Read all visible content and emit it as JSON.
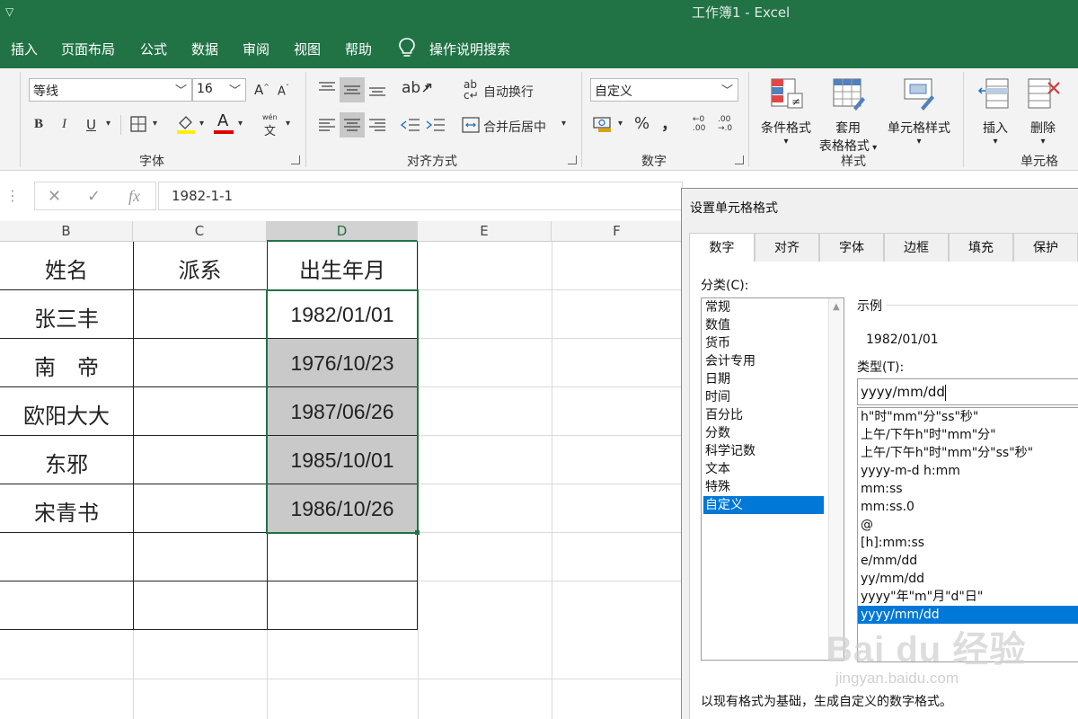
{
  "titlebar": {
    "qat_arrow": "▽",
    "title": "工作簿1 - Excel"
  },
  "menu": {
    "tabs": [
      "插入",
      "页面布局",
      "公式",
      "数据",
      "审阅",
      "视图",
      "帮助"
    ],
    "tellme": "操作说明搜索"
  },
  "ribbon": {
    "font": {
      "name": "等线",
      "size": "16",
      "group_label": "字体",
      "grow": "A",
      "shrink": "A",
      "bold": "B",
      "italic": "I",
      "underline": "U",
      "font_color_letter": "A",
      "phonetic": "wén"
    },
    "align": {
      "wrap_text": "自动换行",
      "merge_center": "合并后居中",
      "group_label": "对齐方式"
    },
    "number": {
      "format": "自定义",
      "percent": "%",
      "comma": "，",
      "group_label": "数字"
    },
    "styles": {
      "conditional": "条件格式",
      "table_line1": "套用",
      "table_line2": "表格格式",
      "cell_styles": "单元格样式",
      "group_label": "样式"
    },
    "cells": {
      "insert": "插入",
      "delete": "删除",
      "group_label": "单元格"
    },
    "colors": {
      "highlight": "#ffee00",
      "font_color": "#e00000",
      "accent": "#217346"
    }
  },
  "formula_bar": {
    "cancel": "✕",
    "enter": "✓",
    "fx": "fx",
    "value": "1982-1-1"
  },
  "sheet": {
    "columns": [
      "B",
      "C",
      "D",
      "E",
      "F"
    ],
    "selected_column": "D",
    "header_row": {
      "name": "姓名",
      "faction": "派系",
      "birth": "出生年月"
    },
    "rows": [
      {
        "name": "张三丰",
        "birth": "1982/01/01"
      },
      {
        "name": "南　帝",
        "birth": "1976/10/23"
      },
      {
        "name": "欧阳大大",
        "birth": "1987/06/26"
      },
      {
        "name": "东邪",
        "birth": "1985/10/01"
      },
      {
        "name": "宋青书",
        "birth": "1986/10/26"
      }
    ]
  },
  "dialog": {
    "title": "设置单元格格式",
    "tabs": [
      "数字",
      "对齐",
      "字体",
      "边框",
      "填充",
      "保护"
    ],
    "active_tab": "数字",
    "category_label": "分类(C):",
    "categories": [
      "常规",
      "数值",
      "货币",
      "会计专用",
      "日期",
      "时间",
      "百分比",
      "分数",
      "科学记数",
      "文本",
      "特殊",
      "自定义"
    ],
    "selected_category": "自定义",
    "sample_label": "示例",
    "sample_value": "1982/01/01",
    "type_label": "类型(T):",
    "type_value": "yyyy/mm/dd",
    "type_options": [
      "h\"时\"mm\"分\"ss\"秒\"",
      "上午/下午h\"时\"mm\"分\"",
      "上午/下午h\"时\"mm\"分\"ss\"秒\"",
      "yyyy-m-d h:mm",
      "mm:ss",
      "mm:ss.0",
      "@",
      "[h]:mm:ss",
      "e/mm/dd",
      "yy/mm/dd",
      "yyyy\"年\"m\"月\"d\"日\"",
      "yyyy/mm/dd"
    ],
    "selected_type": "yyyy/mm/dd",
    "hint": "以现有格式为基础，生成自定义的数字格式。"
  },
  "watermark": {
    "brand": "Bai du 经验",
    "url": "jingyan.baidu.com"
  }
}
